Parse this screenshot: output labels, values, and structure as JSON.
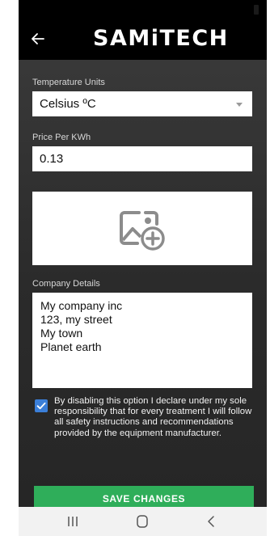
{
  "app": {
    "brand": "SAMiTECH"
  },
  "form": {
    "temperature_units": {
      "label": "Temperature Units",
      "value": "Celsius ºC"
    },
    "price_per_kwh": {
      "label": "Price Per KWh",
      "value": "0.13"
    },
    "company_details": {
      "label": "Company Details",
      "lines": [
        "My company inc",
        "123, my street",
        "My town",
        "Planet earth"
      ]
    },
    "consent": {
      "checked": true,
      "text": "By disabling this option I declare under my sole responsibility that for every treatment I will follow all safety instructions and recommendations provided by the equipment manufacturer."
    },
    "save_label": "SAVE CHANGES"
  },
  "colors": {
    "accent_green": "#2fae5a",
    "checkbox_blue": "#3b7fd9",
    "header_black": "#000000"
  },
  "icons": {
    "back": "back-arrow-icon",
    "image_placeholder": "add-image-icon",
    "nav_recents": "recents-icon",
    "nav_home": "home-icon",
    "nav_back": "nav-back-icon"
  }
}
